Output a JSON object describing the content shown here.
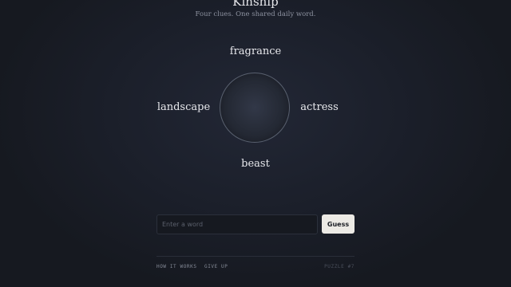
{
  "header": {
    "title": "Kinship",
    "subtitle": "Four clues. One shared daily word."
  },
  "clues": {
    "top": "fragrance",
    "left": "landscape",
    "right": "actress",
    "bottom": "beast"
  },
  "guess": {
    "placeholder": "Enter a word",
    "value": "",
    "button_label": "Guess"
  },
  "footer": {
    "how_it_works": "HOW IT WORKS",
    "give_up": "GIVE UP",
    "puzzle_label": "PUZZLE #7"
  },
  "colors": {
    "background": "#1b1f2a",
    "text": "#e8e9ed",
    "button": "#eceae5"
  }
}
